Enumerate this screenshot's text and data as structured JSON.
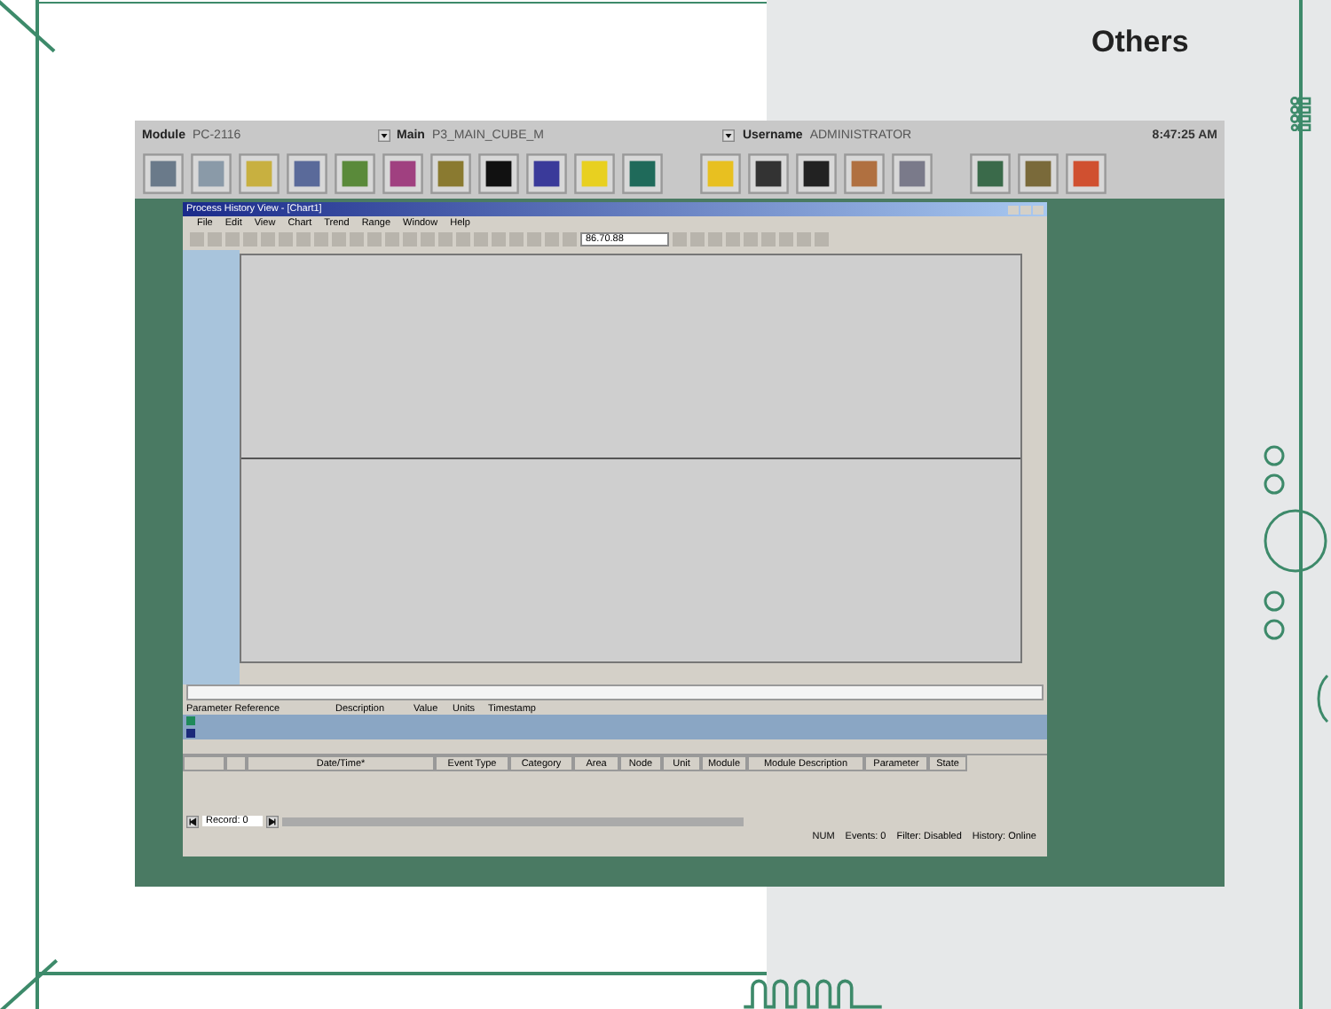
{
  "section_title": "Others",
  "app_bar": {
    "module_label": "Module",
    "module_value": "PC-2116",
    "main_label": "Main",
    "main_value": "P3_MAIN_CUBE_M",
    "username_label": "Username",
    "username_value": "ADMINISTRATOR",
    "clock": "8:47:25 AM"
  },
  "window": {
    "title": "Process History View - [Chart1]",
    "menu": [
      "File",
      "Edit",
      "View",
      "Chart",
      "Trend",
      "Range",
      "Window",
      "Help"
    ],
    "toolbar_field": "86.70.88",
    "parameters": {
      "columns": [
        "Parameter Reference",
        "Description",
        "Value",
        "Units",
        "Timestamp"
      ],
      "rows": [
        {
          "color": "#1f8a5a",
          "selected": true
        },
        {
          "color": "#1b2a7a",
          "selected": true
        }
      ]
    },
    "events": {
      "columns": [
        "Date/Time*",
        "Event Type",
        "Category",
        "Area",
        "Node",
        "Unit",
        "Module",
        "Module Description",
        "Parameter",
        "State"
      ]
    },
    "record": "Record: 0",
    "status": [
      "NUM",
      "Events: 0",
      "Filter: Disabled",
      "History: Online"
    ]
  }
}
